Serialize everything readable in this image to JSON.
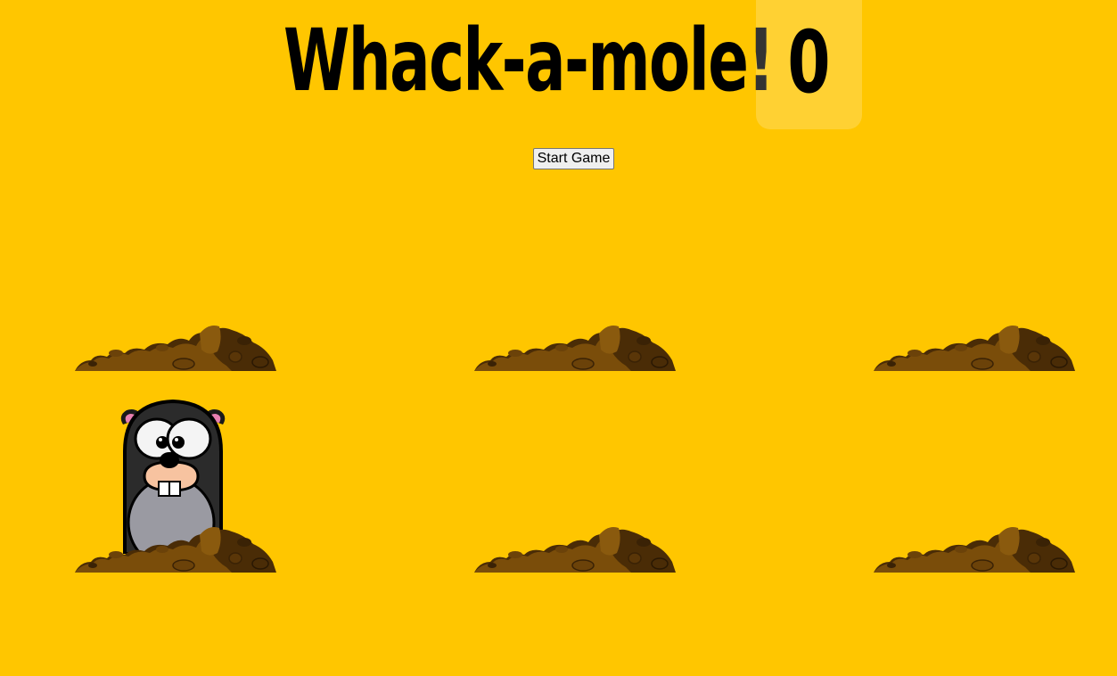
{
  "game": {
    "title": "Whack-a-mole!",
    "score": "0",
    "start_button_label": "Start Game"
  },
  "board": {
    "rows": 2,
    "columns": 3,
    "holes": [
      {
        "id": 1,
        "mole_visible": false
      },
      {
        "id": 2,
        "mole_visible": false
      },
      {
        "id": 3,
        "mole_visible": false
      },
      {
        "id": 4,
        "mole_visible": true
      },
      {
        "id": 5,
        "mole_visible": false
      },
      {
        "id": 6,
        "mole_visible": false
      }
    ]
  },
  "colors": {
    "background": "#ffc600",
    "dirt_dark": "#4a2c06",
    "dirt_light": "#7a4d0a"
  }
}
